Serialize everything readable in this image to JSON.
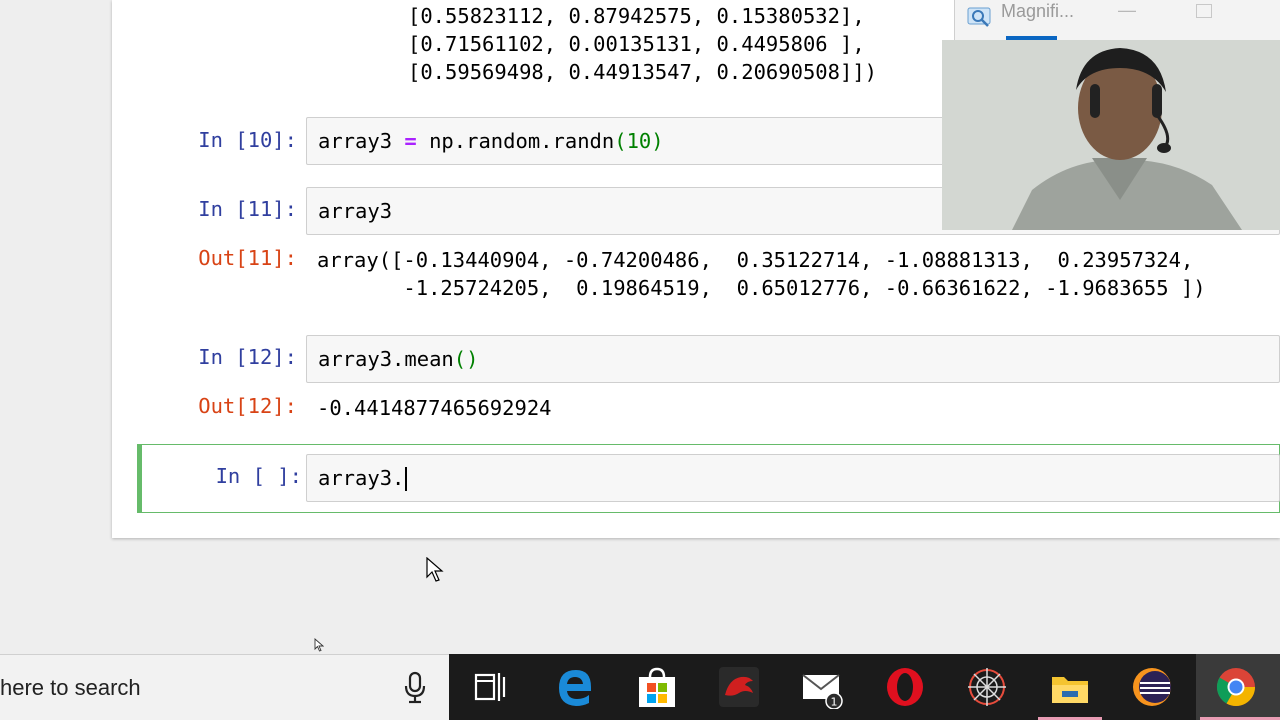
{
  "notebook": {
    "prev_output_lines": [
      "[0.55823112, 0.87942575, 0.15380532],",
      "[0.71561102, 0.00135131, 0.4495806 ],",
      "[0.59569498, 0.44913547, 0.20690508]])"
    ],
    "cells": [
      {
        "in_prompt": "In [10]:",
        "code_var": "array3 ",
        "code_eq": "=",
        "code_mid": " np.random.randn",
        "code_open": "(",
        "code_num": "10",
        "code_close": ")"
      },
      {
        "in_prompt": "In [11]:",
        "code": "array3",
        "out_prompt": "Out[11]:",
        "output_lines": [
          "array([-0.13440904, -0.74200486,  0.35122714, -1.08881313,  0.23957324,",
          "       -1.25724205,  0.19864519,  0.65012776, -0.66361622, -1.9683655 ])"
        ]
      },
      {
        "in_prompt": "In [12]:",
        "code_var": "array3.mean",
        "code_parens": "()",
        "out_prompt": "Out[12]:",
        "output": "-0.4414877465692924"
      },
      {
        "in_prompt": "In [ ]:",
        "code": "array3."
      }
    ]
  },
  "magnifier": {
    "title": "Magnifi...",
    "minimize": "—"
  },
  "taskbar": {
    "search_text": "here to search",
    "icons": [
      "task-view-icon",
      "edge-icon",
      "store-icon",
      "msi-dragon-icon",
      "mail-icon",
      "opera-icon",
      "spider-web-icon",
      "file-explorer-icon",
      "eclipse-icon",
      "chrome-icon"
    ],
    "mail_badge": "1"
  }
}
